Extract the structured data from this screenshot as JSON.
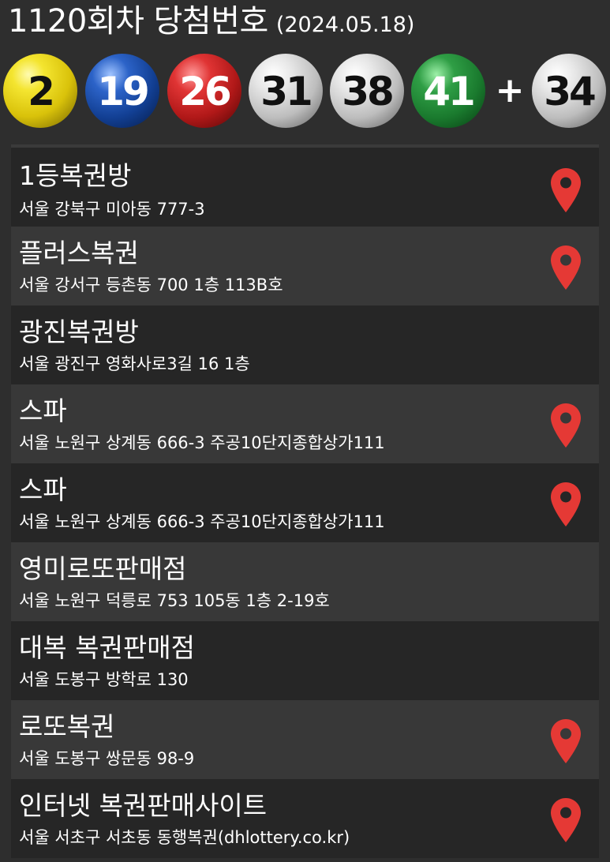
{
  "header": {
    "title": "1120회차 당첨번호",
    "date": "(2024.05.18)"
  },
  "balls": [
    {
      "number": "2",
      "color": "yellow"
    },
    {
      "number": "19",
      "color": "blue"
    },
    {
      "number": "26",
      "color": "red"
    },
    {
      "number": "31",
      "color": "gray"
    },
    {
      "number": "38",
      "color": "gray"
    },
    {
      "number": "41",
      "color": "green"
    }
  ],
  "plus": "+",
  "bonus": {
    "number": "34",
    "color": "gray"
  },
  "colors": {
    "background": "#2e2e2e",
    "row_dark": "#262626",
    "row_light": "#383838",
    "pin": "#e53935"
  },
  "stores": [
    {
      "name": "1등복권방",
      "address": "서울 강북구 미아동 777-3",
      "map_icon": "location-pin-icon"
    },
    {
      "name": "플러스복권",
      "address": "서울 강서구 등촌동 700 1층 113B호",
      "map_icon": "location-pin-icon"
    },
    {
      "name": "광진복권방",
      "address": "서울 광진구 영화사로3길 16 1층",
      "map_icon": ""
    },
    {
      "name": "스파",
      "address": "서울 노원구 상계동 666-3 주공10단지종합상가111",
      "map_icon": "location-pin-icon"
    },
    {
      "name": "스파",
      "address": "서울 노원구 상계동 666-3 주공10단지종합상가111",
      "map_icon": "location-pin-icon"
    },
    {
      "name": "영미로또판매점",
      "address": "서울 노원구 덕릉로 753 105동 1층 2-19호",
      "map_icon": ""
    },
    {
      "name": "대복 복권판매점",
      "address": "서울 도봉구 방학로 130",
      "map_icon": ""
    },
    {
      "name": "로또복권",
      "address": "서울 도봉구 쌍문동 98-9",
      "map_icon": "location-pin-icon"
    },
    {
      "name": "인터넷 복권판매사이트",
      "address": "서울 서초구 서초동 동행복권(dhlottery.co.kr)",
      "map_icon": "location-pin-icon"
    }
  ]
}
